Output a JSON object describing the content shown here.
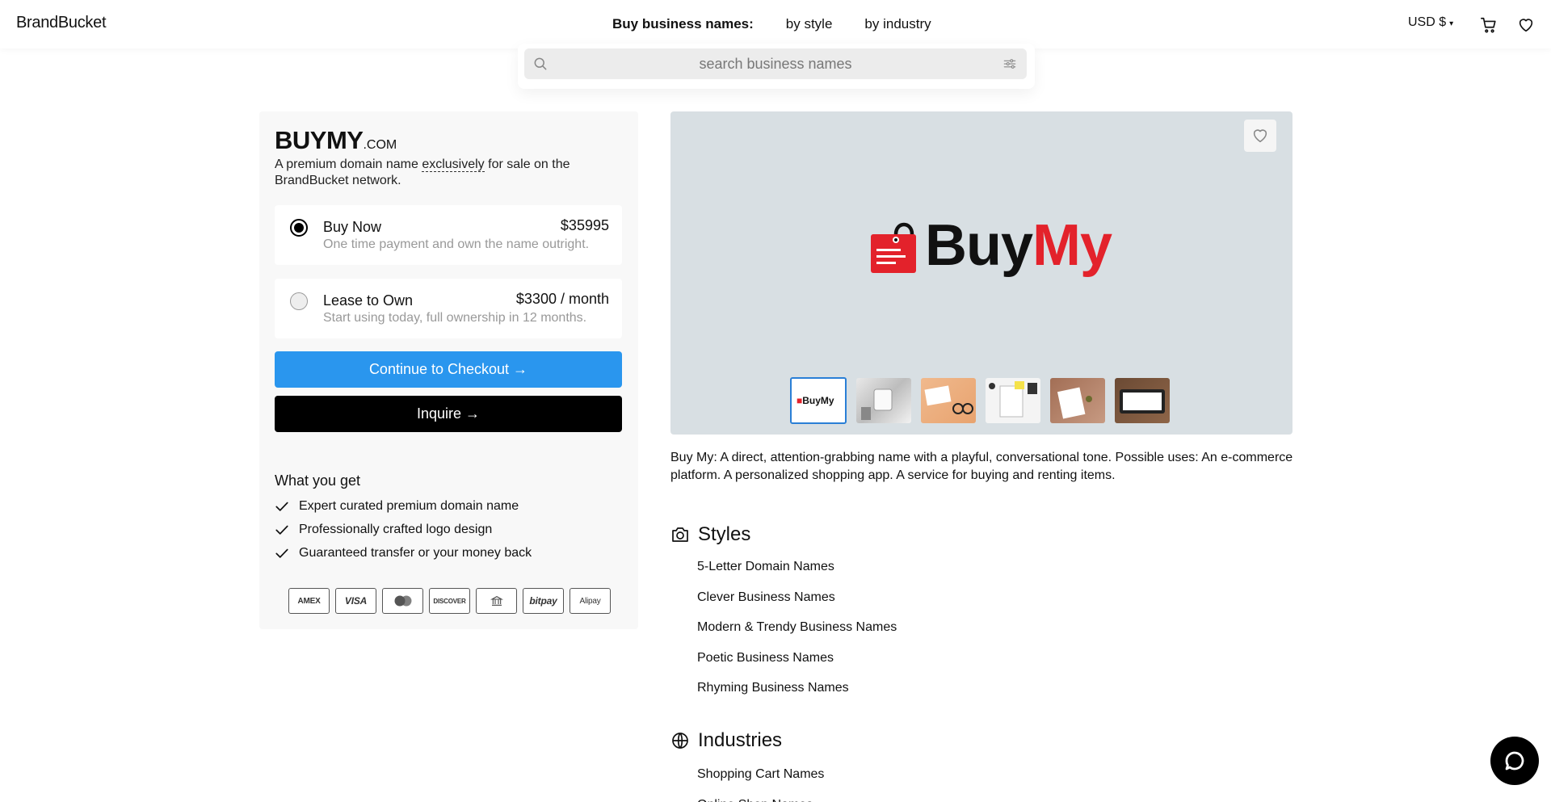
{
  "header": {
    "logo": "BrandBucket",
    "nav_title": "Buy business names:",
    "nav_links": [
      "by style",
      "by industry"
    ],
    "currency": "USD $",
    "currency_caret": "▾"
  },
  "search": {
    "placeholder": "search business names"
  },
  "domain": {
    "name": "BUYMY",
    "tld": ".COM",
    "desc_before": "A premium domain name ",
    "desc_emph": "exclusively",
    "desc_after": " for sale on the BrandBucket network."
  },
  "options": [
    {
      "title": "Buy Now",
      "price": "$35995",
      "sub": "One time payment and own the name outright.",
      "selected": true
    },
    {
      "title": "Lease to Own",
      "price": "$3300 / month",
      "sub": "Start using today, full ownership in 12 months.",
      "selected": false
    }
  ],
  "buttons": {
    "checkout": "Continue to Checkout →",
    "inquire": "Inquire →"
  },
  "what_you_get": {
    "title": "What you get",
    "items": [
      "Expert curated premium domain name",
      "Professionally crafted logo design",
      "Guaranteed transfer or your money back"
    ]
  },
  "payments": [
    "AMEX",
    "VISA",
    "mastercard",
    "DISCOVER",
    "bank",
    "bitpay",
    "Alipay"
  ],
  "hero": {
    "brand_buy": "Buy",
    "brand_my": "My",
    "thumb_label": "BuyMy"
  },
  "description": "Buy My: A direct, attention-grabbing name with a playful, conversational tone. Possible uses: An e-commerce platform. A personalized shopping app. A service for buying and renting items.",
  "styles": {
    "title": "Styles",
    "items": [
      "5-Letter Domain Names",
      "Clever Business Names",
      "Modern & Trendy Business Names",
      "Poetic Business Names",
      "Rhyming Business Names"
    ]
  },
  "industries": {
    "title": "Industries",
    "items": [
      "Shopping Cart Names",
      "Online Shop Names"
    ]
  },
  "colors": {
    "accent_blue": "#2a96ee",
    "brand_red": "#e3222b",
    "hero_bg": "#d8dfe3"
  }
}
